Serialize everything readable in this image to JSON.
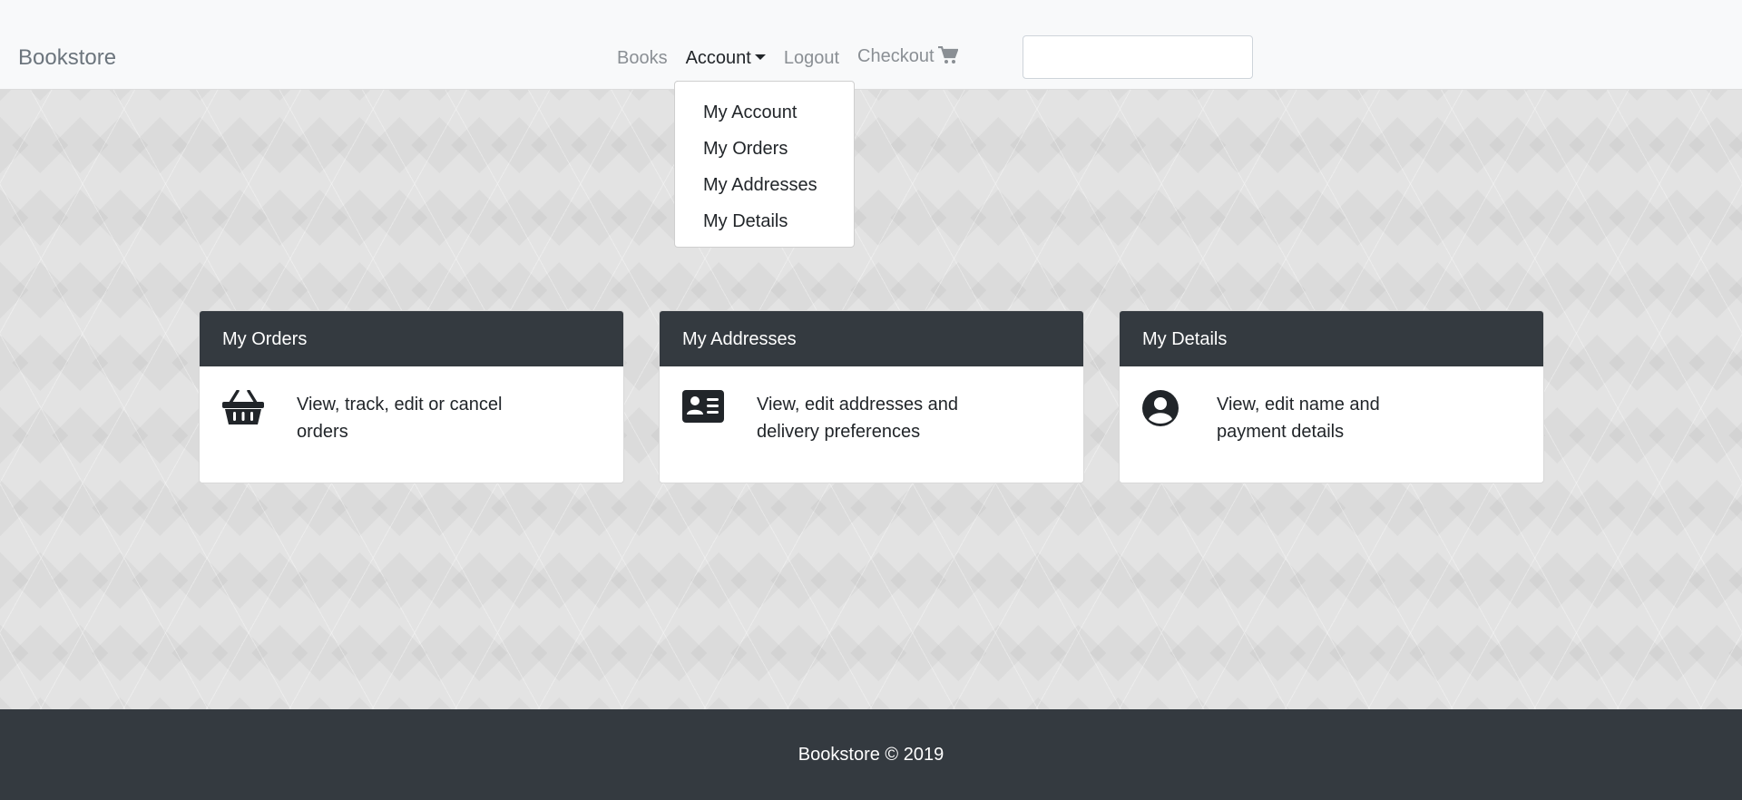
{
  "navbar": {
    "brand": "Bookstore",
    "links": {
      "books": "Books",
      "account": "Account",
      "logout": "Logout",
      "checkout": "Checkout"
    },
    "search": {
      "value": "",
      "placeholder": ""
    }
  },
  "account_dropdown": {
    "items": [
      "My Account",
      "My Orders",
      "My Addresses",
      "My Details"
    ]
  },
  "cards": [
    {
      "title": "My Orders",
      "icon": "basket-icon",
      "text": "View, track, edit or cancel orders"
    },
    {
      "title": "My Addresses",
      "icon": "address-card-icon",
      "text": "View, edit addresses and delivery preferences"
    },
    {
      "title": "My Details",
      "icon": "user-circle-icon",
      "text": "View, edit name and payment details"
    }
  ],
  "footer": {
    "text": "Bookstore © 2019"
  },
  "colors": {
    "navbar_bg": "#f8f9fa",
    "dark": "#343a40",
    "muted": "#6c757d",
    "page_bg": "#e3e3e3"
  }
}
